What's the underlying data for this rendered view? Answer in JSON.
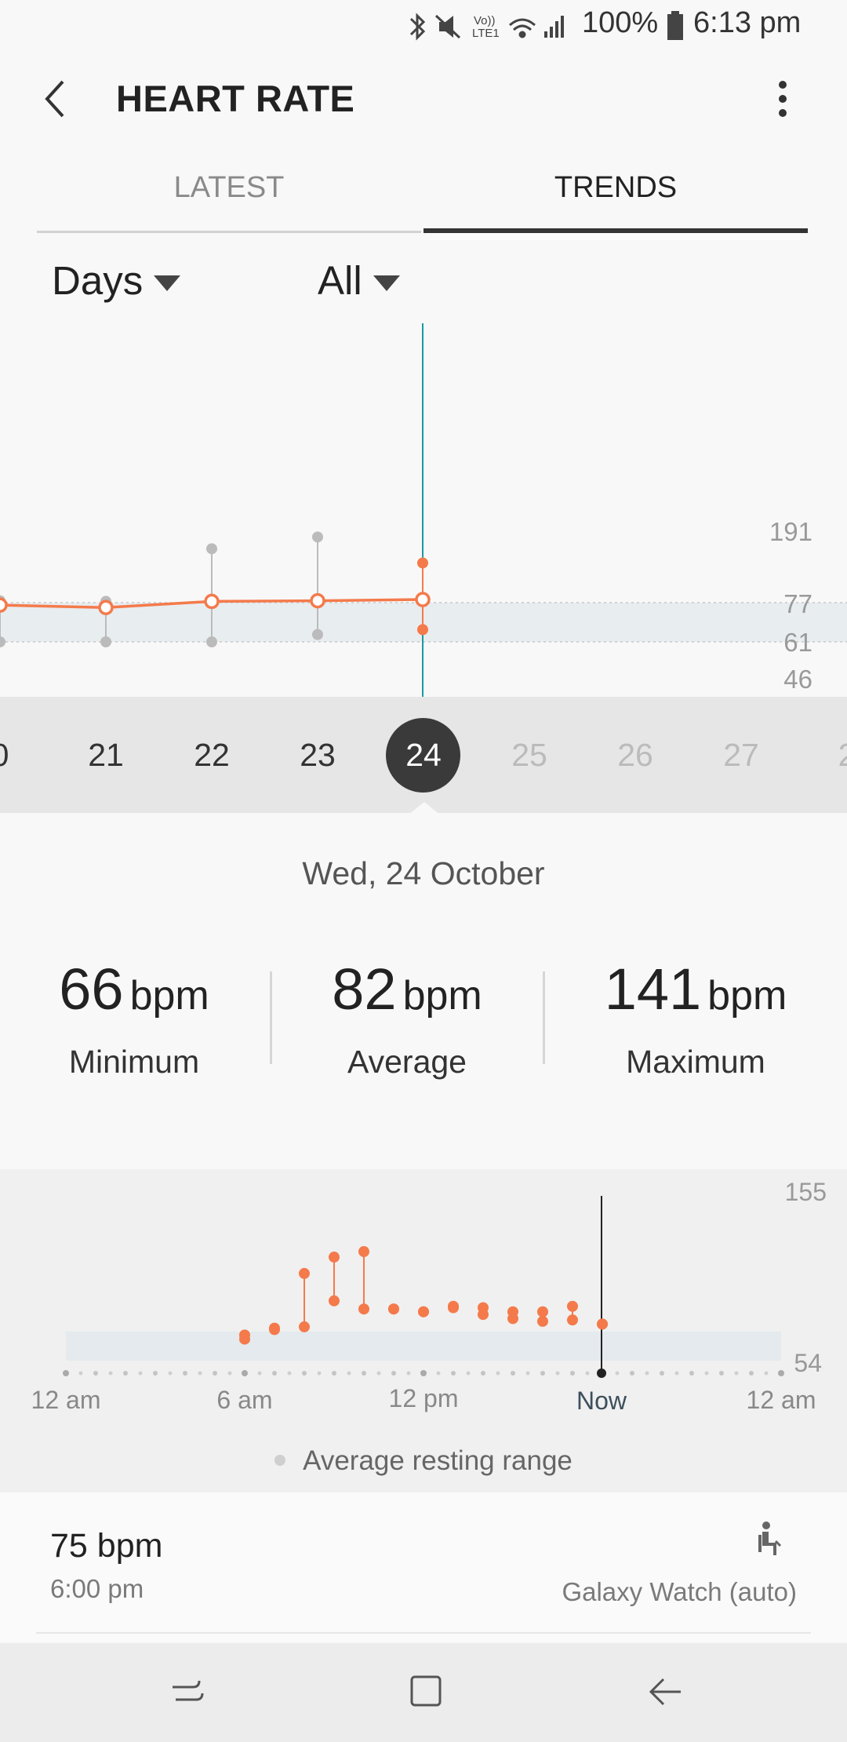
{
  "status_bar": {
    "battery_text": "100%",
    "time": "6:13 pm",
    "network_label": "Vo) LTE1"
  },
  "header": {
    "title": "HEART RATE"
  },
  "tabs": [
    {
      "label": "LATEST",
      "selected": false
    },
    {
      "label": "TRENDS",
      "selected": true
    }
  ],
  "filters": {
    "period": "Days",
    "type": "All"
  },
  "trend_chart": {
    "accent_color": "#f47a4b",
    "y_ticks": [
      "191",
      "77",
      "61",
      "46"
    ]
  },
  "days": [
    {
      "label": "0",
      "state": "past"
    },
    {
      "label": "21",
      "state": "past"
    },
    {
      "label": "22",
      "state": "past"
    },
    {
      "label": "23",
      "state": "past"
    },
    {
      "label": "24",
      "state": "selected"
    },
    {
      "label": "25",
      "state": "future"
    },
    {
      "label": "26",
      "state": "future"
    },
    {
      "label": "27",
      "state": "future"
    },
    {
      "label": "2",
      "state": "future"
    }
  ],
  "selected_date": "Wed, 24 October",
  "stats": {
    "minimum": {
      "value": "66",
      "unit": "bpm",
      "label": "Minimum"
    },
    "average": {
      "value": "82",
      "unit": "bpm",
      "label": "Average"
    },
    "maximum": {
      "value": "141",
      "unit": "bpm",
      "label": "Maximum"
    }
  },
  "daily_chart": {
    "y_max_label": "155",
    "y_min_label": "54",
    "x_labels": [
      "12 am",
      "6 am",
      "12 pm",
      "Now",
      "12 am"
    ]
  },
  "legend_label": "Average resting range",
  "latest_reading": {
    "value": "75 bpm",
    "time": "6:00 pm",
    "source": "Galaxy Watch (auto)"
  },
  "chart_data": [
    {
      "type": "line",
      "title": "",
      "xlabel": "",
      "ylabel": "",
      "categories": [
        "20",
        "21",
        "22",
        "23",
        "24"
      ],
      "series": [
        {
          "values": [
            76,
            75,
            79,
            80,
            82
          ]
        }
      ],
      "range_min": [
        61,
        61,
        61,
        64,
        66
      ],
      "range_max": [
        80,
        79,
        164,
        183,
        141
      ],
      "resting_range": [
        61,
        77
      ],
      "y_ticks": [
        191,
        77,
        61,
        46
      ],
      "grid": false
    },
    {
      "type": "scatter",
      "title": "",
      "xlabel": "",
      "ylabel": "",
      "x": [
        "6:00",
        "7:00",
        "8:00",
        "9:00",
        "10:00",
        "11:00",
        "12:00",
        "13:00",
        "14:00",
        "15:00",
        "16:00",
        "17:00",
        "18:00"
      ],
      "min": [
        64,
        71,
        73,
        92,
        86,
        86,
        84,
        87,
        82,
        79,
        77,
        78,
        75
      ],
      "max": [
        67,
        72,
        112,
        124,
        128,
        86,
        84,
        88,
        87,
        84,
        84,
        88,
        75
      ],
      "resting_range": [
        64,
        77
      ],
      "ylim": [
        54,
        155
      ],
      "grid": false
    }
  ]
}
